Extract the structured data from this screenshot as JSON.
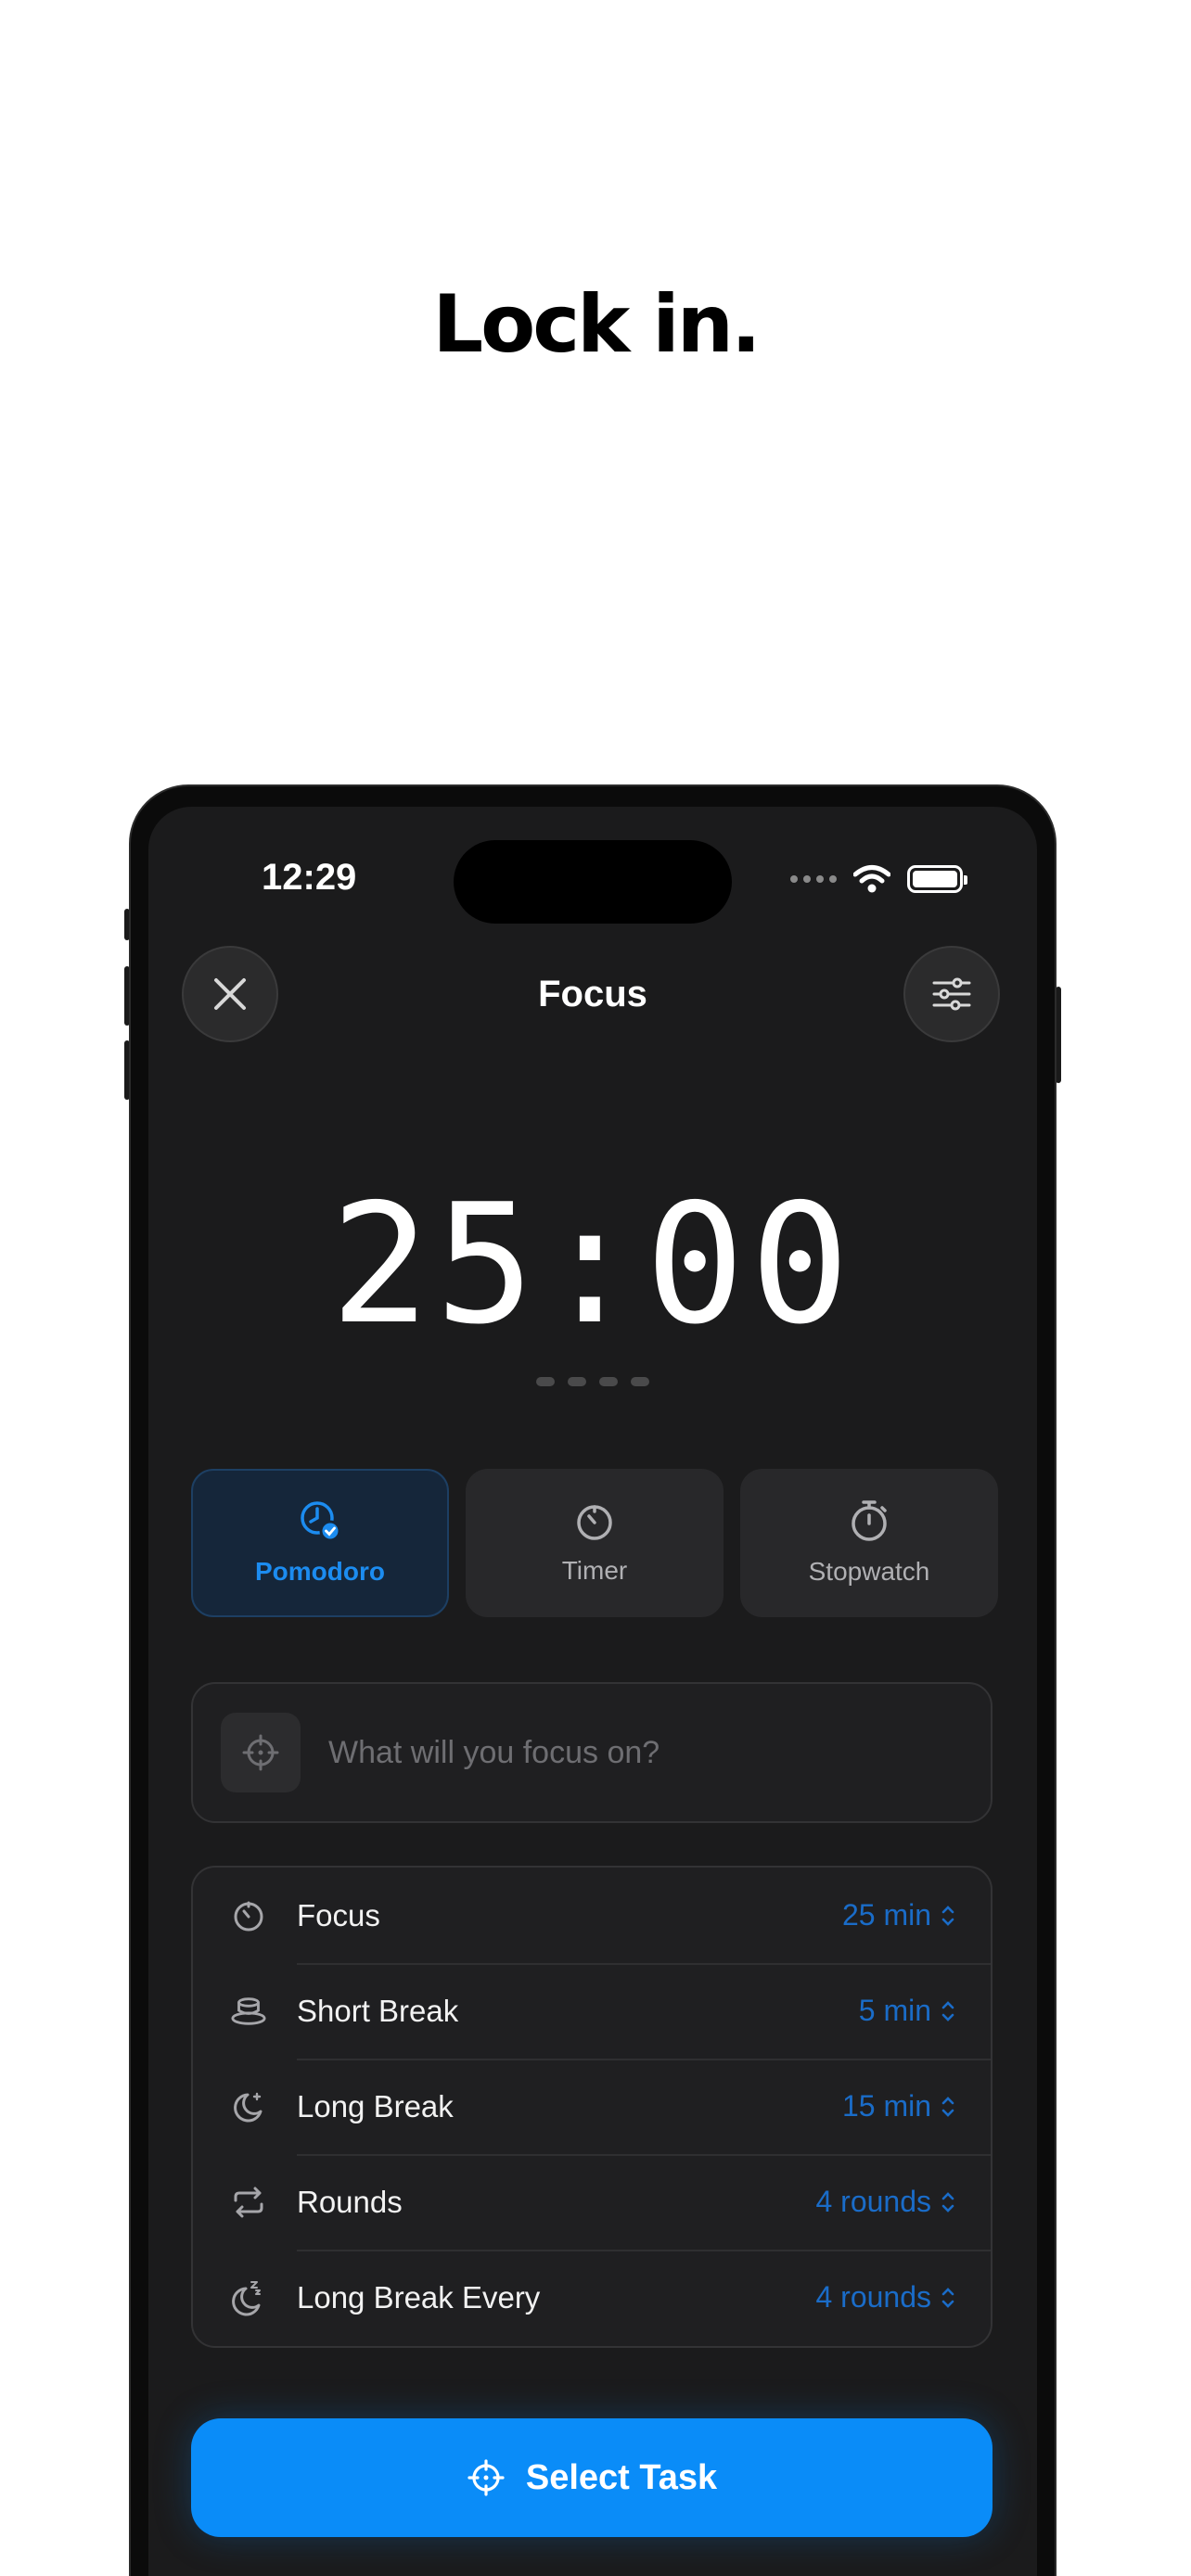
{
  "headline": "Lock in.",
  "status_bar": {
    "time": "12:29"
  },
  "nav": {
    "title": "Focus"
  },
  "timer": {
    "display": "25:00"
  },
  "modes": [
    {
      "label": "Pomodoro",
      "icon": "clock-check-icon",
      "active": true
    },
    {
      "label": "Timer",
      "icon": "timer-icon",
      "active": false
    },
    {
      "label": "Stopwatch",
      "icon": "stopwatch-icon",
      "active": false
    }
  ],
  "focus_input": {
    "placeholder": "What will you focus on?",
    "value": ""
  },
  "settings": [
    {
      "label": "Focus",
      "value": "25 min",
      "icon": "timer-icon"
    },
    {
      "label": "Short Break",
      "value": "5 min",
      "icon": "coffee-cup-icon"
    },
    {
      "label": "Long Break",
      "value": "15 min",
      "icon": "moon-icon"
    },
    {
      "label": "Rounds",
      "value": "4 rounds",
      "icon": "repeat-icon"
    },
    {
      "label": "Long Break Every",
      "value": "4 rounds",
      "icon": "sleep-moon-icon"
    }
  ],
  "cta": {
    "label": "Select Task"
  },
  "colors": {
    "accent": "#0a8cf8",
    "value_text": "#1a6cc8",
    "active_mode_text": "#1c8cf0"
  }
}
